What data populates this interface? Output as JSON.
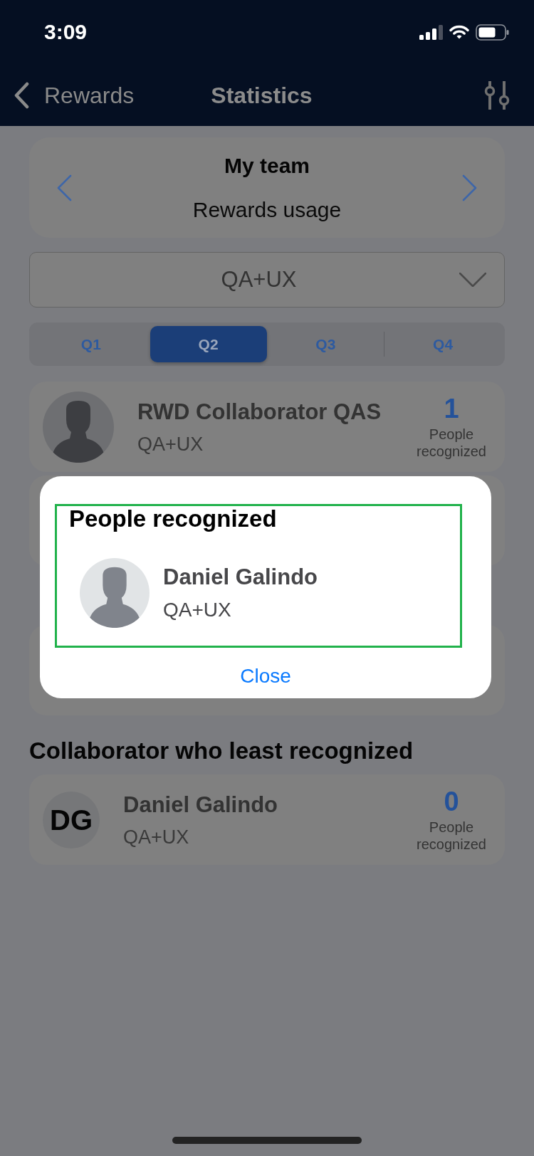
{
  "status_bar": {
    "time": "3:09"
  },
  "nav_bar": {
    "back_label": "Rewards",
    "title": "Statistics"
  },
  "header_card": {
    "title": "My team",
    "subtitle": "Rewards usage"
  },
  "team_dropdown": {
    "value": "QA+UX"
  },
  "quarter_tabs": [
    {
      "label": "Q1",
      "selected": false
    },
    {
      "label": "Q2",
      "selected": true
    },
    {
      "label": "Q3",
      "selected": false
    },
    {
      "label": "Q4",
      "selected": false
    }
  ],
  "content": [
    {
      "kind": "card",
      "avatar": {
        "kind": "silhouette"
      },
      "name": "RWD Collaborator QAS",
      "team": "QA+UX",
      "count": "1",
      "count_label": "People recognized"
    },
    {
      "kind": "covered_card"
    },
    {
      "kind": "covered_heading"
    },
    {
      "kind": "covered_card"
    },
    {
      "kind": "heading",
      "text": "Collaborator who least recognized"
    },
    {
      "kind": "card",
      "avatar": {
        "kind": "initials",
        "text": "DG"
      },
      "name": "Daniel Galindo",
      "team": "QA+UX",
      "count": "0",
      "count_label": "People recognized"
    }
  ],
  "modal": {
    "title": "People recognized",
    "people": [
      {
        "avatar": {
          "kind": "silhouette"
        },
        "name": "Daniel Galindo",
        "team": "QA+UX"
      }
    ],
    "close_label": "Close"
  }
}
